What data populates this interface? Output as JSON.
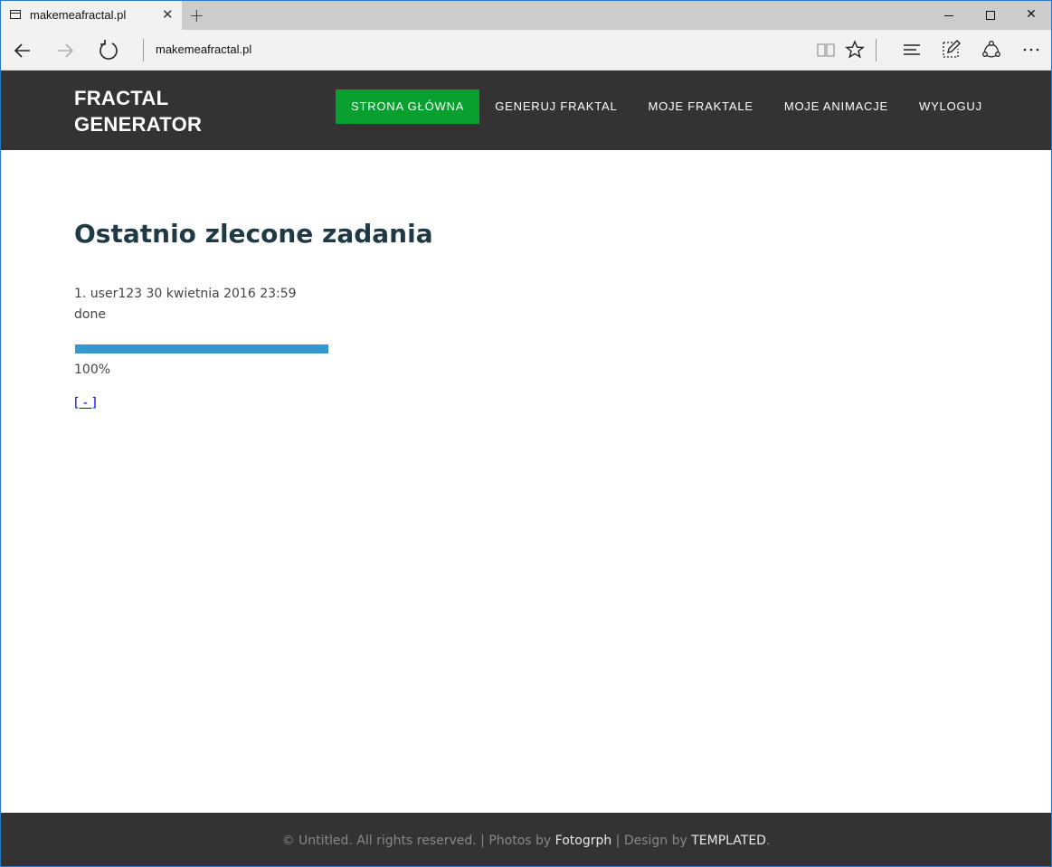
{
  "browser": {
    "tab_title": "makemeafractal.pl",
    "tab_close": "✕",
    "new_tab": "+",
    "url": "makemeafractal.pl",
    "window_close": "✕"
  },
  "header": {
    "logo_line1": "FRACTAL",
    "logo_line2": "GENERATOR",
    "nav": [
      {
        "label": "STRONA GŁÓWNA",
        "active": true
      },
      {
        "label": "GENERUJ FRAKTAL",
        "active": false
      },
      {
        "label": "MOJE FRAKTALE",
        "active": false
      },
      {
        "label": "MOJE ANIMACJE",
        "active": false
      },
      {
        "label": "WYLOGUJ",
        "active": false
      }
    ],
    "accent_color": "#07a02f"
  },
  "main": {
    "title": "Ostatnio zlecone zadania",
    "job": {
      "line": "1. user123 30 kwietnia 2016 23:59",
      "status": "done",
      "progress_fraction": 1.0,
      "progress_text": "100%",
      "toggle_label": "[ - ]"
    },
    "progress_color": "#3298ce"
  },
  "footer": {
    "prefix": "© Untitled. All rights reserved. | Photos by ",
    "photos_by": "Fotogrph",
    "middle": " | Design by ",
    "design_by": "TEMPLATED",
    "suffix": "."
  }
}
